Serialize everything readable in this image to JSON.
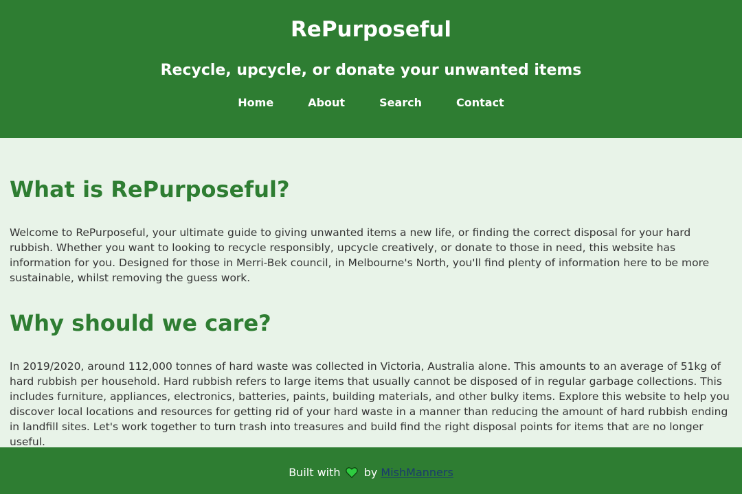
{
  "header": {
    "title": "RePurposeful",
    "tagline": "Recycle, upcycle, or donate your unwanted items"
  },
  "nav": {
    "items": [
      {
        "label": "Home"
      },
      {
        "label": "About"
      },
      {
        "label": "Search"
      },
      {
        "label": "Contact"
      }
    ]
  },
  "sections": [
    {
      "heading": "What is RePurposeful?",
      "text": "Welcome to RePurposeful, your ultimate guide to giving unwanted items a new life, or finding the correct disposal for your hard rubbish. Whether you want to looking to recycle responsibly, upcycle creatively, or donate to those in need, this website has information for you. Designed for those in Merri-Bek council, in Melbourne's North, you'll find plenty of information here to be more sustainable, whilst removing the guess work."
    },
    {
      "heading": "Why should we care?",
      "text": "In 2019/2020, around 112,000 tonnes of hard waste was collected in Victoria, Australia alone. This amounts to an average of 51kg of hard rubbish per household. Hard rubbish refers to large items that usually cannot be disposed of in regular garbage collections. This includes furniture, appliances, electronics, batteries, paints, building materials, and other bulky items. Explore this website to help you discover local locations and resources for getting rid of your hard waste in a manner than reducing the amount of hard rubbish ending in landfill sites. Let's work together to turn trash into treasures and build find the right disposal points for items that are no longer useful."
    }
  ],
  "footer": {
    "prefix": "Built with",
    "by": "by",
    "author": "MishManners",
    "icon": "heart-icon"
  },
  "colors": {
    "brand_green": "#2e7d32",
    "page_background": "#e8f3e8",
    "heart": "#2ecc40"
  }
}
